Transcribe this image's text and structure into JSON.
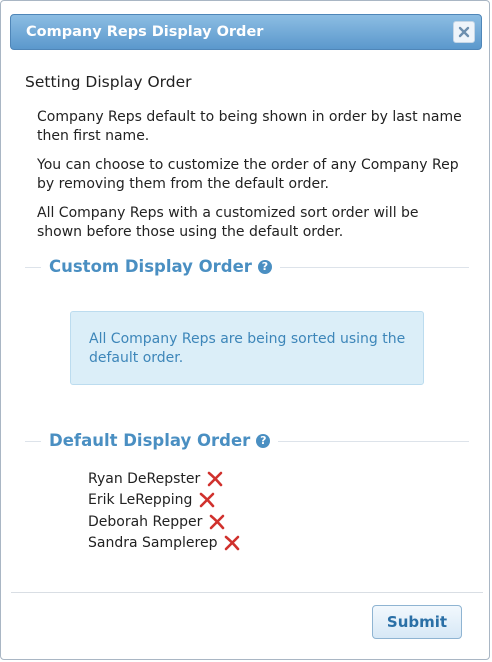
{
  "dialog": {
    "title": "Company Reps Display Order",
    "close_icon": "close-icon"
  },
  "content": {
    "heading": "Setting Display Order",
    "paragraphs": [
      "Company Reps default to being shown in order by last name then first name.",
      "You can choose to customize the order of any Company Rep by removing them from the default order.",
      "All Company Reps with a customized sort order will be shown before those using the default order."
    ]
  },
  "custom_section": {
    "title": "Custom Display Order",
    "help_icon": "help-icon",
    "info": "All Company Reps are being sorted using the default order."
  },
  "default_section": {
    "title": "Default Display Order",
    "help_icon": "help-icon",
    "reps": [
      {
        "name": "Ryan DeRepster",
        "remove_icon": "remove-icon"
      },
      {
        "name": "Erik LeRepping",
        "remove_icon": "remove-icon"
      },
      {
        "name": "Deborah Repper",
        "remove_icon": "remove-icon"
      },
      {
        "name": "Sandra Samplerep",
        "remove_icon": "remove-icon"
      }
    ]
  },
  "footer": {
    "submit_label": "Submit"
  },
  "colors": {
    "titlebar": "#5b98cc",
    "section_title": "#4a8fc2",
    "info_background": "#dbeef8",
    "info_text": "#3d86b9",
    "remove_icon": "#d0312d"
  }
}
